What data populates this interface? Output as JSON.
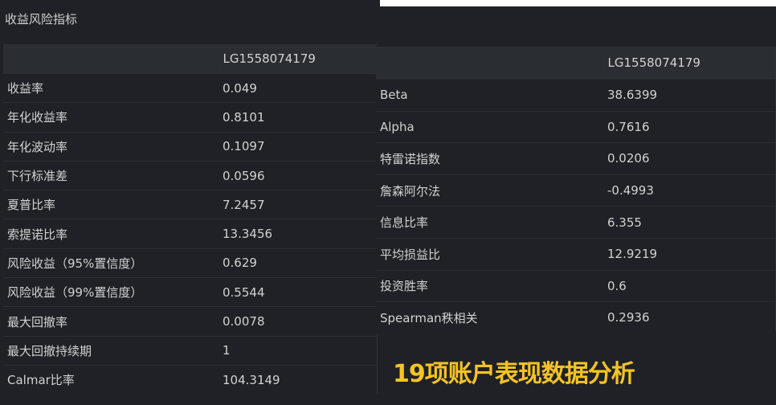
{
  "panel": {
    "title": "收益风险指标"
  },
  "left_table": {
    "header": [
      "",
      "LG1558074179"
    ],
    "rows": [
      [
        "收益率",
        "0.049"
      ],
      [
        "年化收益率",
        "0.8101"
      ],
      [
        "年化波动率",
        "0.1097"
      ],
      [
        "下行标准差",
        "0.0596"
      ],
      [
        "夏普比率",
        "7.2457"
      ],
      [
        "索提诺比率",
        "13.3456"
      ],
      [
        "风险收益（95%置信度）",
        "0.629"
      ],
      [
        "风险收益（99%置信度）",
        "0.5544"
      ],
      [
        "最大回撤率",
        "0.0078"
      ],
      [
        "最大回撤持续期",
        "1"
      ],
      [
        "Calmar比率",
        "104.3149"
      ]
    ]
  },
  "right_table": {
    "header": [
      "",
      "LG1558074179"
    ],
    "rows": [
      [
        "Beta",
        "38.6399"
      ],
      [
        "Alpha",
        "0.7616"
      ],
      [
        "特雷诺指数",
        "0.0206"
      ],
      [
        "詹森阿尔法",
        "-0.4993"
      ],
      [
        "信息比率",
        "6.355"
      ],
      [
        "平均损益比",
        "12.9219"
      ],
      [
        "投资胜率",
        "0.6"
      ],
      [
        "Spearman秩相关",
        "0.2936"
      ]
    ]
  },
  "caption": "19项账户表现数据分析",
  "colors": {
    "background": "#1f2126",
    "header": "#2a2d32",
    "caption": "#f5c326"
  }
}
